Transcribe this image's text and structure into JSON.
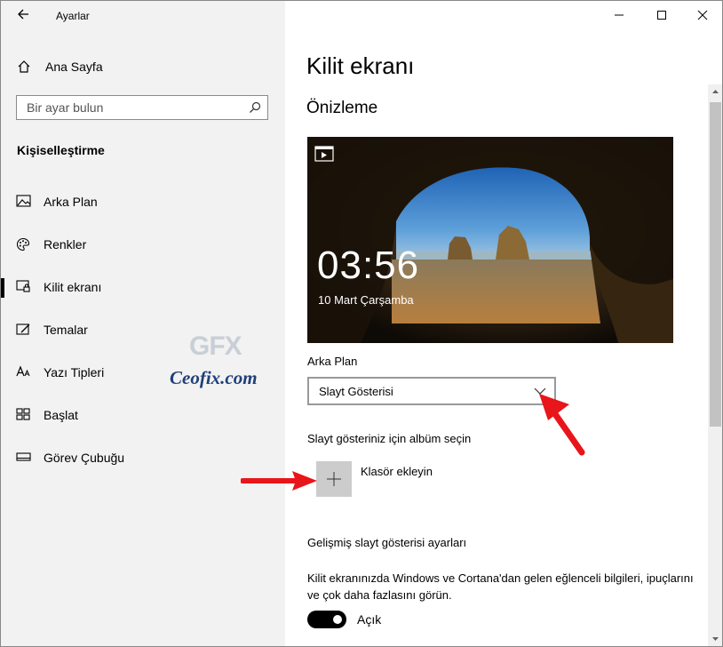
{
  "window": {
    "title": "Ayarlar",
    "minimize_icon": "minimize-icon",
    "maximize_icon": "maximize-icon",
    "close_icon": "close-icon"
  },
  "sidebar": {
    "home_label": "Ana Sayfa",
    "search_placeholder": "Bir ayar bulun",
    "section_title": "Kişiselleştirme",
    "items": [
      {
        "label": "Arka Plan",
        "icon": "picture-icon"
      },
      {
        "label": "Renkler",
        "icon": "palette-icon"
      },
      {
        "label": "Kilit ekranı",
        "icon": "lock-screen-icon",
        "active": true
      },
      {
        "label": "Temalar",
        "icon": "themes-icon"
      },
      {
        "label": "Yazı Tipleri",
        "icon": "fonts-icon"
      },
      {
        "label": "Başlat",
        "icon": "start-icon"
      },
      {
        "label": "Görev Çubuğu",
        "icon": "taskbar-icon"
      }
    ],
    "watermark": {
      "logo": "GFX",
      "site": "Ceofix.com"
    }
  },
  "main": {
    "title": "Kilit ekranı",
    "preview_heading": "Önizleme",
    "preview": {
      "time": "03:56",
      "date": "10 Mart Çarşamba"
    },
    "background_label": "Arka Plan",
    "background_value": "Slayt Gösterisi",
    "album_label": "Slayt gösteriniz için albüm seçin",
    "add_folder_label": "Klasör ekleyin",
    "advanced_link": "Gelişmiş slayt gösterisi ayarları",
    "fun_facts_text": "Kilit ekranınızda Windows ve Cortana'dan gelen eğlenceli bilgileri, ipuçlarını ve çok daha fazlasını görün.",
    "toggle_state": "Açık",
    "toggle_on": true
  },
  "colors": {
    "sidebar_bg": "#f2f2f2",
    "accent_arrow": "#e8151b",
    "toggle_on": "#000000"
  }
}
